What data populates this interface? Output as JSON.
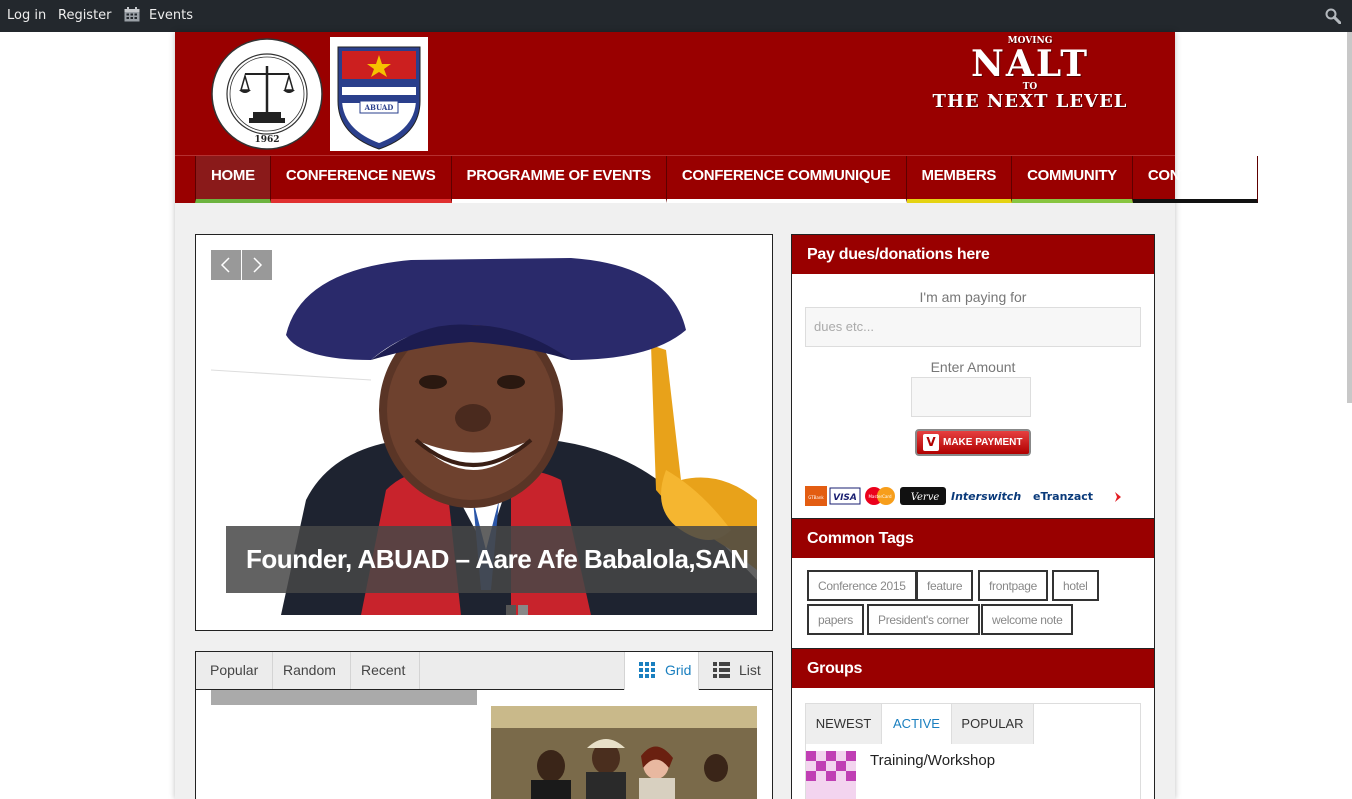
{
  "adminbar": {
    "login": "Log in",
    "register": "Register",
    "events": "Events"
  },
  "header": {
    "slogan_top": "MOVING",
    "slogan_main": "NALT",
    "slogan_to": "TO",
    "slogan_bottom": "THE NEXT LEVEL",
    "logo1_text": "Nigerian Association of Law Teachers",
    "logo1_year": "1962",
    "logo2_text": "AFE BABALOLA UNIVERSITY",
    "logo2_abbr": "ABUAD"
  },
  "nav": {
    "items": [
      {
        "label": "HOME",
        "underline": "#6db33f"
      },
      {
        "label": "CONFERENCE NEWS",
        "underline": "#e03030"
      },
      {
        "label": "PROGRAMME OF EVENTS",
        "underline": "#ffffff"
      },
      {
        "label": "CONFERENCE COMMUNIQUE",
        "underline": "#ffffff"
      },
      {
        "label": "MEMBERS",
        "underline": "#e5d312"
      },
      {
        "label": "COMMUNITY",
        "underline": "#88c540"
      },
      {
        "label": "CONTACT US",
        "underline": "#111111"
      }
    ]
  },
  "slider": {
    "caption": "Founder, ABUAD – Aare Afe Babalola,SAN"
  },
  "posts": {
    "tabs": [
      "Popular",
      "Random",
      "Recent"
    ],
    "grid_label": "Grid",
    "list_label": "List"
  },
  "sidebar": {
    "pay": {
      "title": "Pay dues/donations here",
      "paying_for_label": "I'm am paying for",
      "paying_for_placeholder": "dues etc...",
      "amount_label": "Enter Amount",
      "button_label": "MAKE PAYMENT",
      "card_labels": [
        "GTBank",
        "VISA",
        "MasterCard",
        "Verve",
        "Interswitch",
        "eTranzact"
      ]
    },
    "tags": {
      "title": "Common Tags",
      "items": [
        "Conference 2015",
        "feature",
        "frontpage",
        "hotel",
        "papers",
        "President's corner",
        "welcome note"
      ]
    },
    "groups": {
      "title": "Groups",
      "tabs": [
        "NEWEST",
        "ACTIVE",
        "POPULAR"
      ],
      "active_tab": "ACTIVE",
      "first_group": "Training/Workshop"
    }
  },
  "colors": {
    "brand": "#990000",
    "accent_blue": "#1a7fbf",
    "adminbar": "#23282d"
  }
}
